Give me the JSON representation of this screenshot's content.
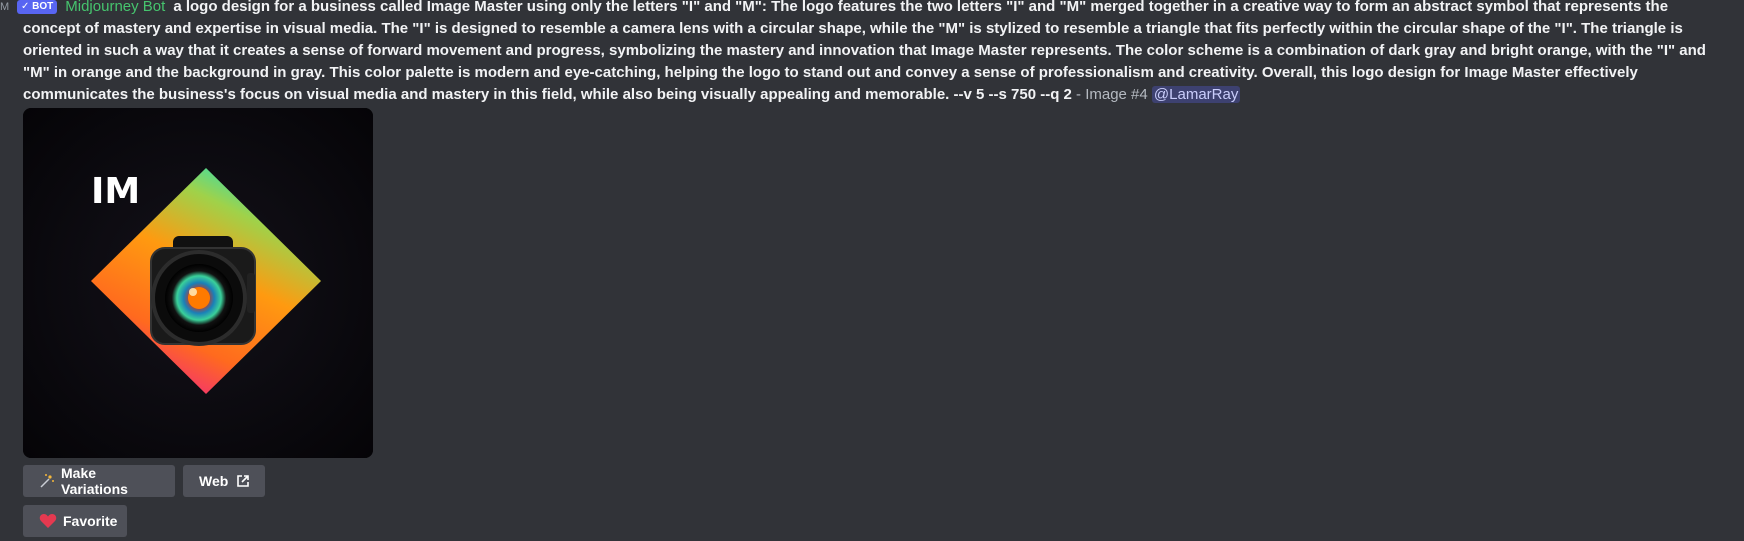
{
  "message": {
    "timestamp_fragment": "M",
    "bot_tag": "✓ BOT",
    "author": "Midjourney Bot",
    "prompt": "a logo design for a business called Image Master using only the letters \"I\" and \"M\": The logo features the two letters \"I\" and \"M\" merged together in a creative way to form an abstract symbol that represents the concept of mastery and expertise in visual media. The \"I\" is designed to resemble a camera lens with a circular shape, while the \"M\" is stylized to resemble a triangle that fits perfectly within the circular shape of the \"I\". The triangle is oriented in such a way that it creates a sense of forward movement and progress, symbolizing the mastery and innovation that Image Master represents. The color scheme is a combination of dark gray and bright orange, with the \"I\" and \"M\" in orange and the background in gray. This color palette is modern and eye-catching, helping the logo to stand out and convey a sense of professionalism and creativity. Overall, this logo design for Image Master effectively communicates the business's focus on visual media and mastery in this field, while also being visually appealing and memorable. --v 5 --s 750 --q 2",
    "image_label": " - Image #4 ",
    "mention": "@LamarRay"
  },
  "attachment": {
    "logo_text": "IM"
  },
  "buttons": {
    "variations_label": "Make Variations",
    "variations_icon": "sparkles-icon",
    "web_label": "Web",
    "web_icon": "external-link-icon",
    "favorite_label": "Favorite",
    "favorite_icon": "heart-icon"
  },
  "colors": {
    "background": "#313338",
    "author": "#46c46e",
    "bot_tag": "#5865f2",
    "button": "#4e5058",
    "heart": "#e53950"
  }
}
